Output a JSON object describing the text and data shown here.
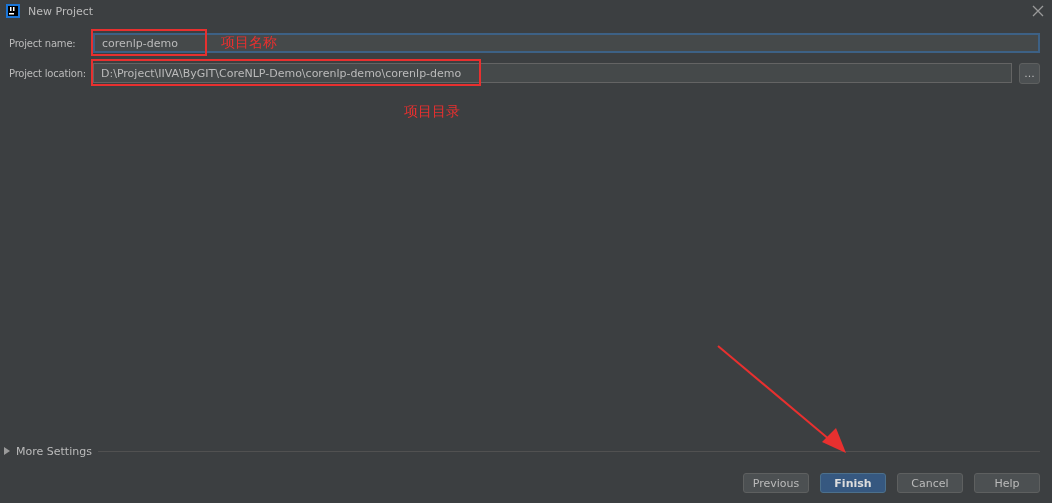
{
  "window": {
    "title": "New Project"
  },
  "fields": [
    {
      "label": "Project name:",
      "value": "corenlp-demo",
      "focused": true
    },
    {
      "label": "Project location:",
      "value": "D:\\Project\\IIVA\\ByGIT\\CoreNLP-Demo\\corenlp-demo\\corenlp-demo",
      "focused": false,
      "browse_label": "..."
    }
  ],
  "more_settings": {
    "label": "More Settings",
    "expanded": false
  },
  "buttons": [
    {
      "label": "Previous",
      "default": false
    },
    {
      "label": "Finish",
      "default": true
    },
    {
      "label": "Cancel",
      "default": false
    },
    {
      "label": "Help",
      "default": false
    }
  ],
  "annotations": [
    {
      "kind": "box"
    },
    {
      "kind": "box"
    },
    {
      "kind": "note",
      "text": "项目名称"
    },
    {
      "kind": "note",
      "text": "项目目录"
    },
    {
      "kind": "arrow"
    }
  ]
}
